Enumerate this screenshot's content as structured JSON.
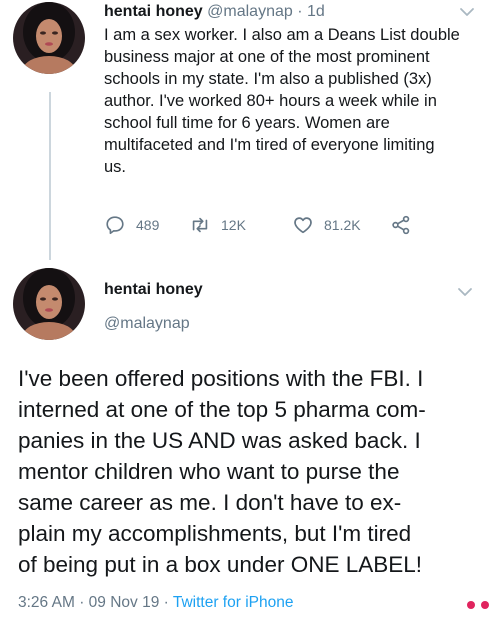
{
  "tweet1": {
    "display_name": "hentai honey",
    "handle": "@malaynap",
    "separator": "·",
    "time_ago": "1d",
    "lines": [
      "I am a sex worker. I also am a Deans List double",
      "business major at one of the most prominent",
      "schools in my state. I'm also a published (3x)",
      "author. I've worked 80+ hours a week while in",
      "school full time for 6 years. Women are",
      "multifaceted and I'm tired of everyone limiting",
      "us."
    ],
    "actions": {
      "replies": "489",
      "retweets": "12K",
      "likes": "81.2K"
    }
  },
  "tweet2": {
    "display_name": "hentai honey",
    "handle": "@malaynap",
    "lines": [
      "I've been offered positions with the FBI. I",
      "interned at one of the top 5 pharma com-",
      "panies in the US AND was asked back. I",
      "mentor children who want to purse the",
      "same career as me. I don't have to ex-",
      "plain my accomplishments, but I'm tired",
      "of being put in a box under ONE LABEL!"
    ],
    "time": "3:26 AM",
    "separator1": "·",
    "date": "09 Nov 19",
    "separator2": "·",
    "source": "Twitter for iPhone"
  },
  "icons": {
    "reply": "reply-icon",
    "retweet": "retweet-icon",
    "like": "heart-icon",
    "share": "share-icon",
    "menu": "chevron-down-icon"
  },
  "colors": {
    "text": "#14171a",
    "secondary": "#657786",
    "link": "#1da1f2",
    "dots": "#e0245e"
  }
}
